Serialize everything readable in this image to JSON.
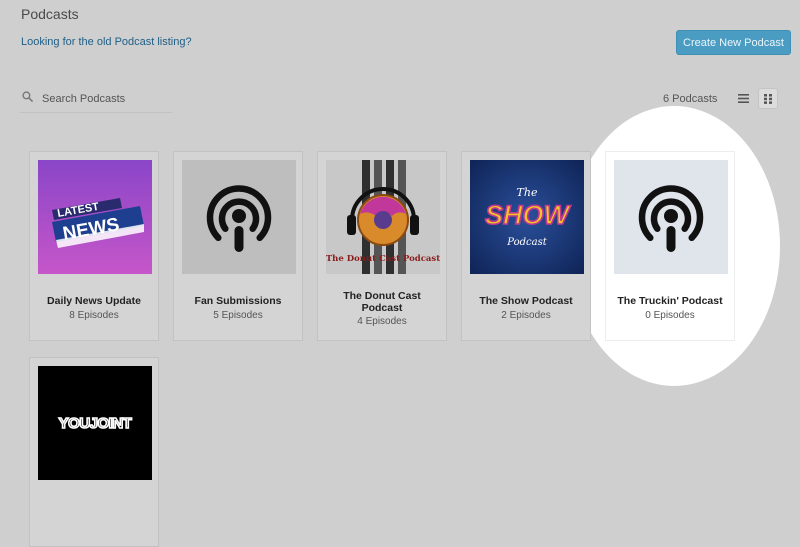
{
  "header": {
    "title": "Podcasts",
    "old_listing_link": "Looking for the old Podcast listing?",
    "create_button": "Create New Podcast"
  },
  "toolbar": {
    "search_placeholder": "Search Podcasts",
    "count_label": "6 Podcasts"
  },
  "colors": {
    "accent": "#4a9cc2",
    "link": "#1f5f86",
    "background": "#cfcfcf"
  },
  "podcasts": [
    {
      "title": "Daily News Update",
      "episodes": "8 Episodes",
      "artwork": "latest-news-artwork",
      "artwork_text": [
        "LATEST",
        "NEWS"
      ]
    },
    {
      "title": "Fan Submissions",
      "episodes": "5 Episodes",
      "artwork": "podcast-icon"
    },
    {
      "title": "The Donut Cast Podcast",
      "episodes": "4 Episodes",
      "artwork": "donut-artwork",
      "artwork_text": [
        "The Donut Cast Podcast"
      ]
    },
    {
      "title": "The Show Podcast",
      "episodes": "2 Episodes",
      "artwork": "show-artwork",
      "artwork_text": [
        "The",
        "SHOW",
        "Podcast"
      ]
    },
    {
      "title": "The Truckin' Podcast",
      "episodes": "0 Episodes",
      "artwork": "podcast-icon",
      "highlighted": true
    },
    {
      "title": "",
      "episodes": "",
      "artwork": "youjoint-logo",
      "artwork_text": [
        "YOUJOINT"
      ]
    }
  ]
}
